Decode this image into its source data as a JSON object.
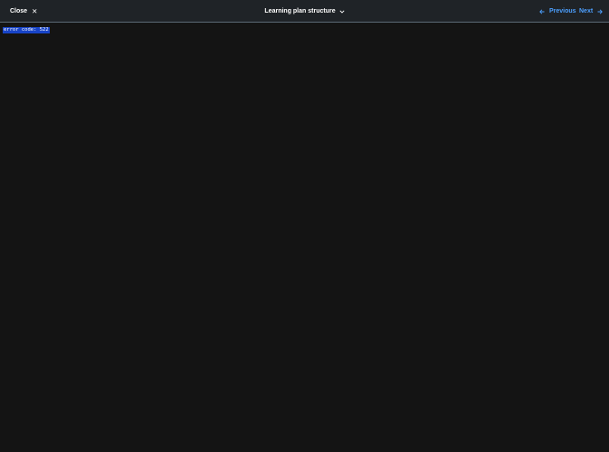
{
  "toolbar": {
    "close_label": "Close",
    "close_icon": "close-icon",
    "title": "Learning plan structure",
    "title_icon": "chevron-down-icon",
    "previous_label": "Previous",
    "previous_icon": "arrow-left-icon",
    "next_label": "Next",
    "next_icon": "arrow-right-icon",
    "accent_color": "#4c9ffe"
  },
  "content": {
    "error_text": "error code: 522",
    "highlight_color": "#1844c8"
  }
}
